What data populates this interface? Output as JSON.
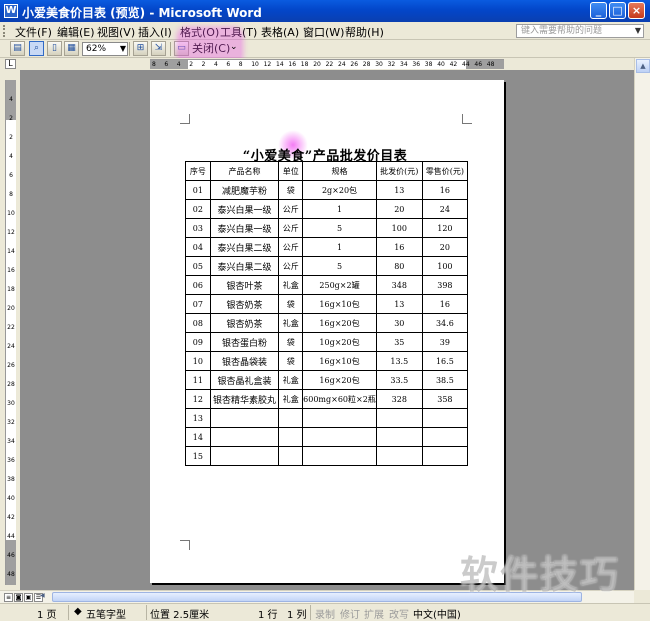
{
  "window": {
    "title": "小爱美食价目表 (预览) - Microsoft Word",
    "buttons": {
      "minimize": "_",
      "maximize": "□",
      "close": "×"
    }
  },
  "menu": {
    "items": [
      "文件(F)",
      "编辑(E)",
      "视图(V)",
      "插入(I)",
      "格式(O)",
      "工具(T)",
      "表格(A)",
      "窗口(W)",
      "帮助(H)"
    ],
    "help_placeholder": "键入需要帮助的问题"
  },
  "toolbar": {
    "zoom": "62%",
    "close_label": "关闭(C)"
  },
  "ruler": {
    "horizontal": [
      "8",
      "6",
      "4",
      "2",
      "2",
      "4",
      "6",
      "8",
      "10",
      "12",
      "14",
      "16",
      "18",
      "20",
      "22",
      "24",
      "26",
      "28",
      "30",
      "32",
      "34",
      "36",
      "38",
      "40",
      "42",
      "44",
      "46",
      "48"
    ],
    "vertical": [
      "4",
      "2",
      "2",
      "4",
      "6",
      "8",
      "10",
      "12",
      "14",
      "16",
      "18",
      "20",
      "22",
      "24",
      "26",
      "28",
      "30",
      "32",
      "34",
      "36",
      "38",
      "40",
      "42",
      "44",
      "46",
      "48"
    ]
  },
  "document": {
    "title": "“小爱美食”产品批发价目表",
    "headers": [
      "序号",
      "产品名称",
      "单位",
      "规格",
      "批发价(元)",
      "零售价(元)"
    ],
    "rows": [
      [
        "01",
        "减肥魔芋粉",
        "袋",
        "2g×20包",
        "13",
        "16"
      ],
      [
        "02",
        "泰兴白果一级",
        "公斤",
        "1",
        "20",
        "24"
      ],
      [
        "03",
        "泰兴白果一级",
        "公斤",
        "5",
        "100",
        "120"
      ],
      [
        "04",
        "泰兴白果二级",
        "公斤",
        "1",
        "16",
        "20"
      ],
      [
        "05",
        "泰兴白果二级",
        "公斤",
        "5",
        "80",
        "100"
      ],
      [
        "06",
        "银杏叶茶",
        "礼盒",
        "250g×2罐",
        "348",
        "398"
      ],
      [
        "07",
        "银杏奶茶",
        "袋",
        "16g×10包",
        "13",
        "16"
      ],
      [
        "08",
        "银杏奶茶",
        "礼盒",
        "16g×20包",
        "30",
        "34.6"
      ],
      [
        "09",
        "银杏蛋白粉",
        "袋",
        "10g×20包",
        "35",
        "39"
      ],
      [
        "10",
        "银杏晶袋装",
        "袋",
        "16g×10包",
        "13.5",
        "16.5"
      ],
      [
        "11",
        "银杏晶礼盒装",
        "礼盒",
        "16g×20包",
        "33.5",
        "38.5"
      ],
      [
        "12",
        "银杏精华素胶丸",
        "礼盒",
        "600mg×60粒×2瓶",
        "328",
        "358"
      ],
      [
        "13",
        "",
        "",
        "",
        "",
        ""
      ],
      [
        "14",
        "",
        "",
        "",
        "",
        ""
      ],
      [
        "15",
        "",
        "",
        "",
        "",
        ""
      ]
    ]
  },
  "statusbar": {
    "page": "1 页",
    "ime": "五笔字型",
    "position": "位置 2.5厘米",
    "line": "1 行",
    "col": "1 列",
    "rec": "录制",
    "trk": "修订",
    "ext": "扩展",
    "ovr": "改写",
    "lang": "中文(中国)"
  },
  "watermark": "软件技巧",
  "colors": {
    "titlebar": "#0a50d8",
    "highlight": "#e84ee8",
    "workspace": "#8d8d8d"
  }
}
